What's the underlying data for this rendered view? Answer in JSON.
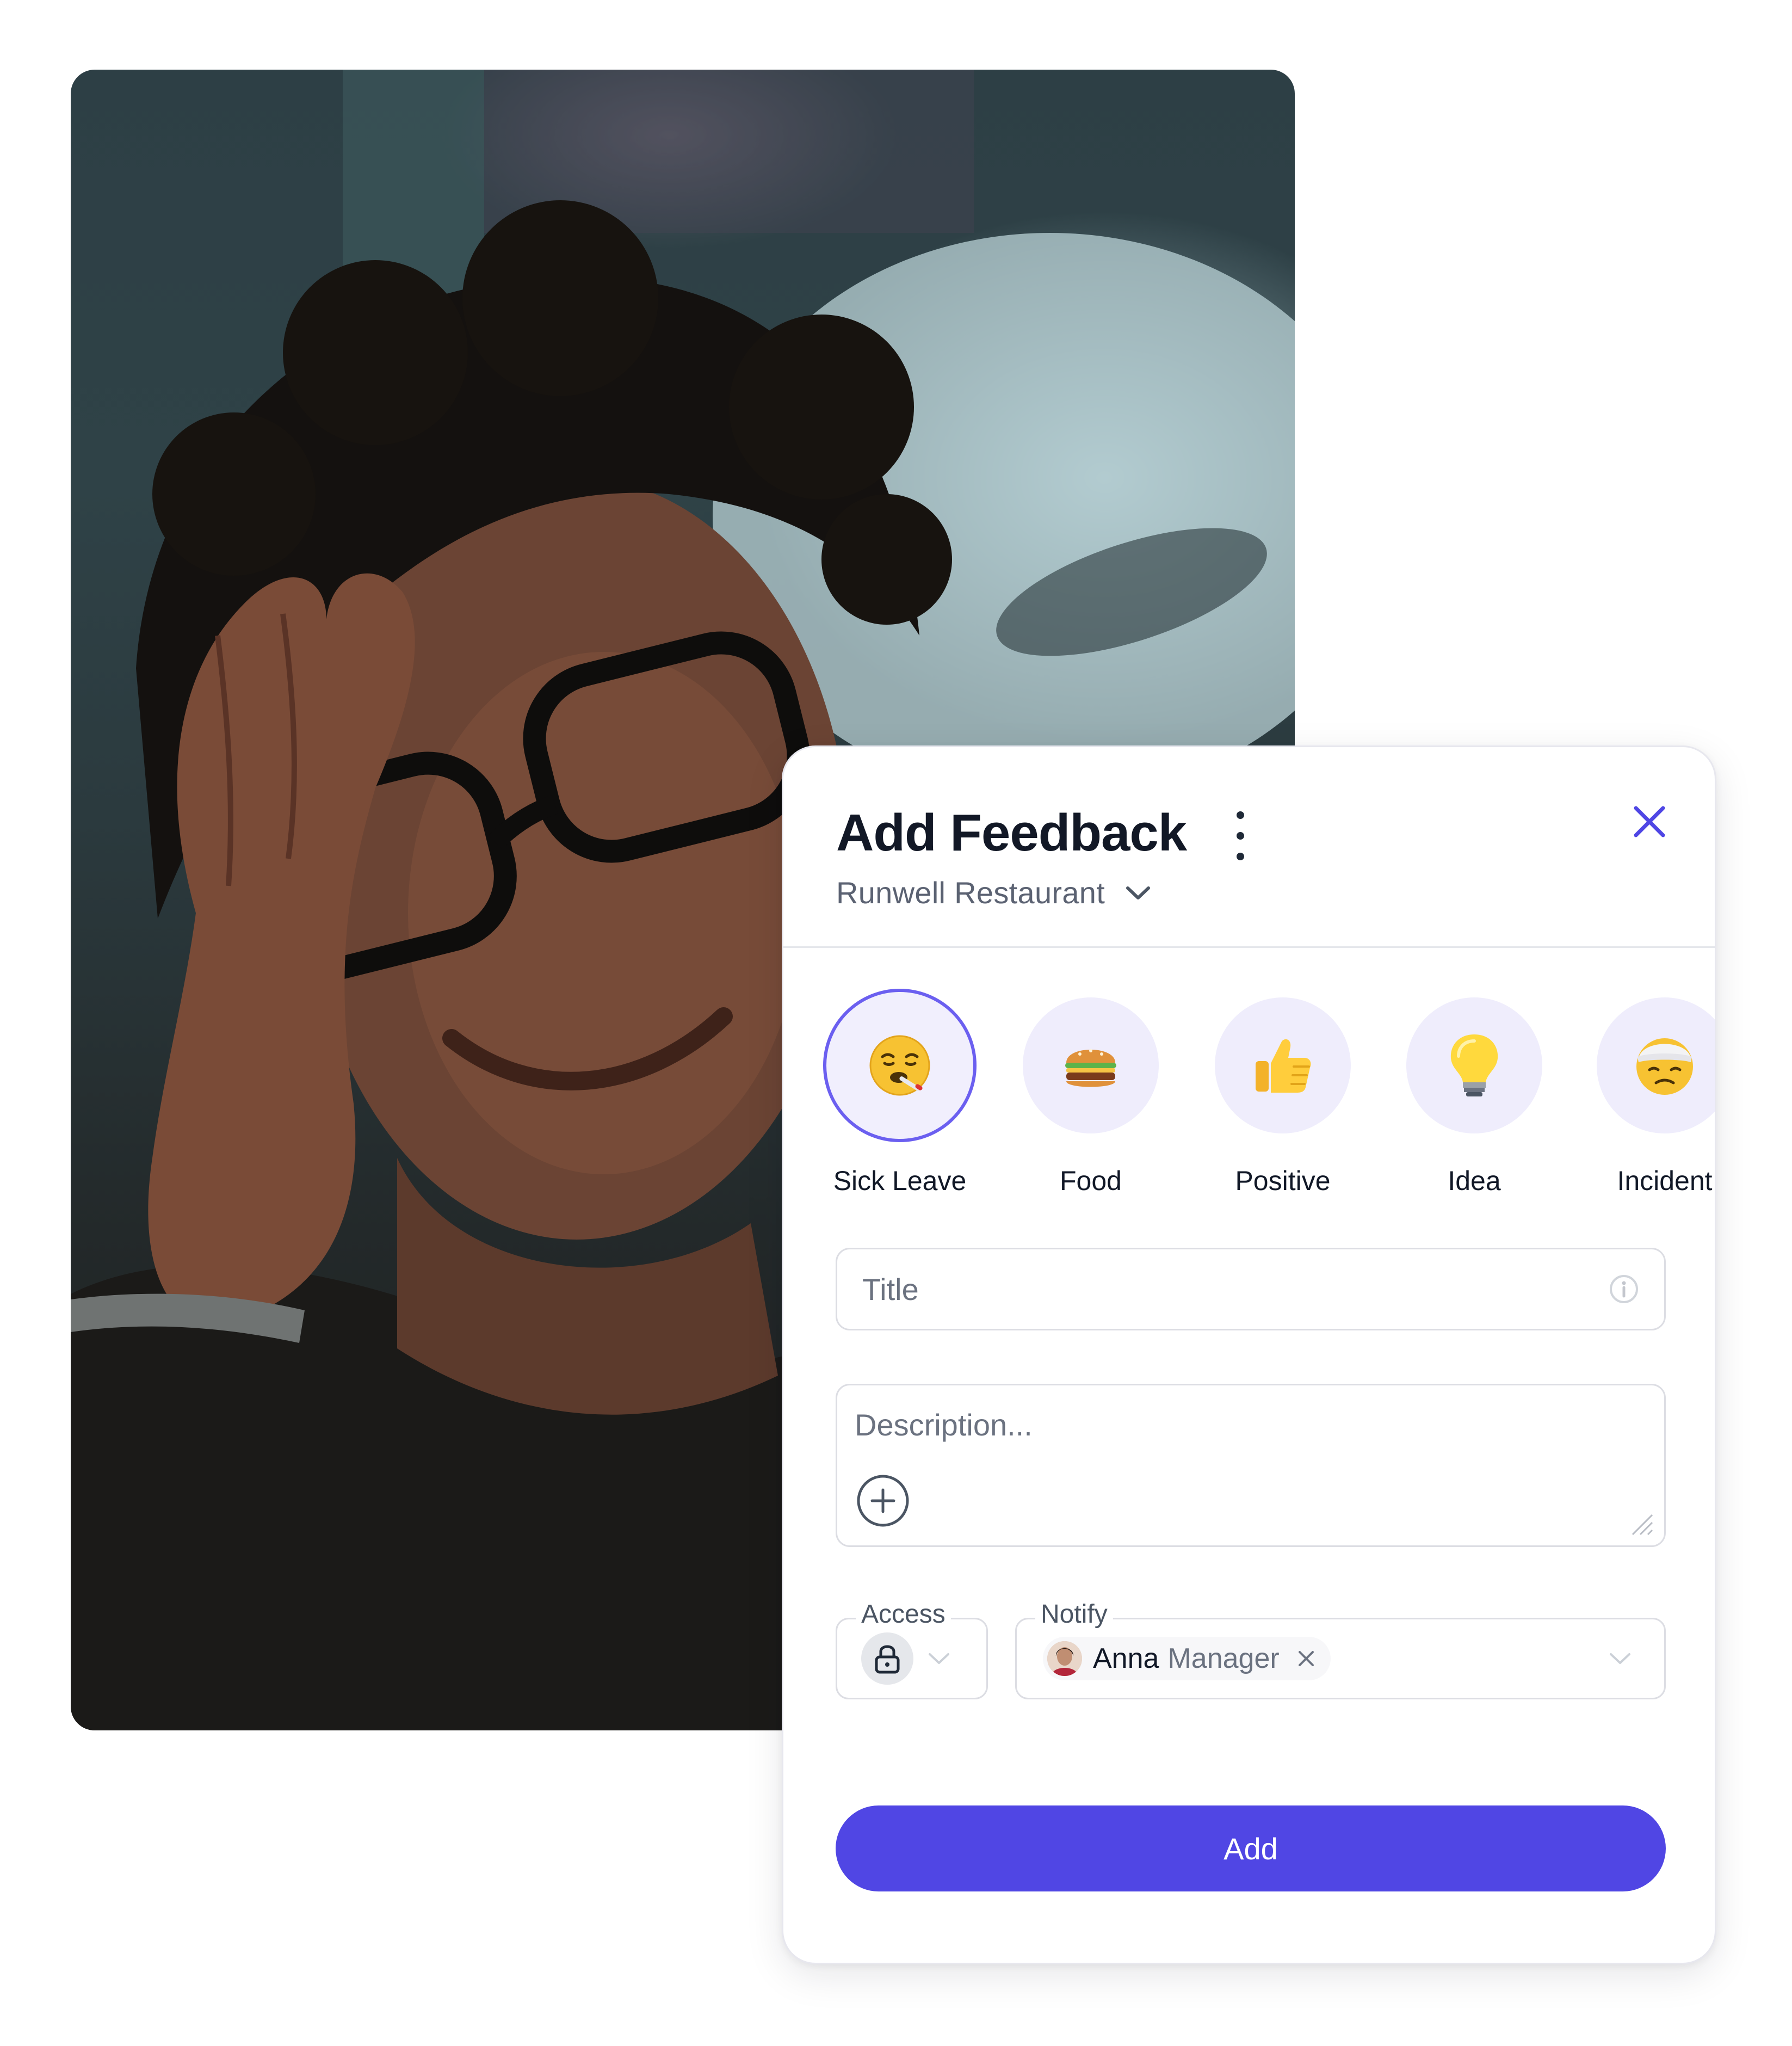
{
  "photo": {
    "subject": "person with glasses holding head"
  },
  "card": {
    "title": "Add Feedback",
    "location": "Runwell Restaurant",
    "categories": [
      {
        "label": "Sick Leave",
        "icon": "sick-face-icon",
        "selected": true
      },
      {
        "label": "Food",
        "icon": "burger-icon",
        "selected": false
      },
      {
        "label": "Positive",
        "icon": "thumbs-up-icon",
        "selected": false
      },
      {
        "label": "Idea",
        "icon": "lightbulb-icon",
        "selected": false
      },
      {
        "label": "Incident",
        "icon": "bandaged-face-icon",
        "selected": false
      }
    ],
    "title_field": {
      "placeholder": "Title",
      "value": ""
    },
    "description_field": {
      "placeholder": "Description...",
      "value": ""
    },
    "access": {
      "label": "Access",
      "value": "lock-icon"
    },
    "notify": {
      "label": "Notify",
      "recipients": [
        {
          "name": "Anna",
          "role": "Manager"
        }
      ]
    },
    "submit_label": "Add",
    "colors": {
      "accent": "#5046e4",
      "category_bg": "#efedfc",
      "selected_ring": "#6b5ff0"
    }
  }
}
